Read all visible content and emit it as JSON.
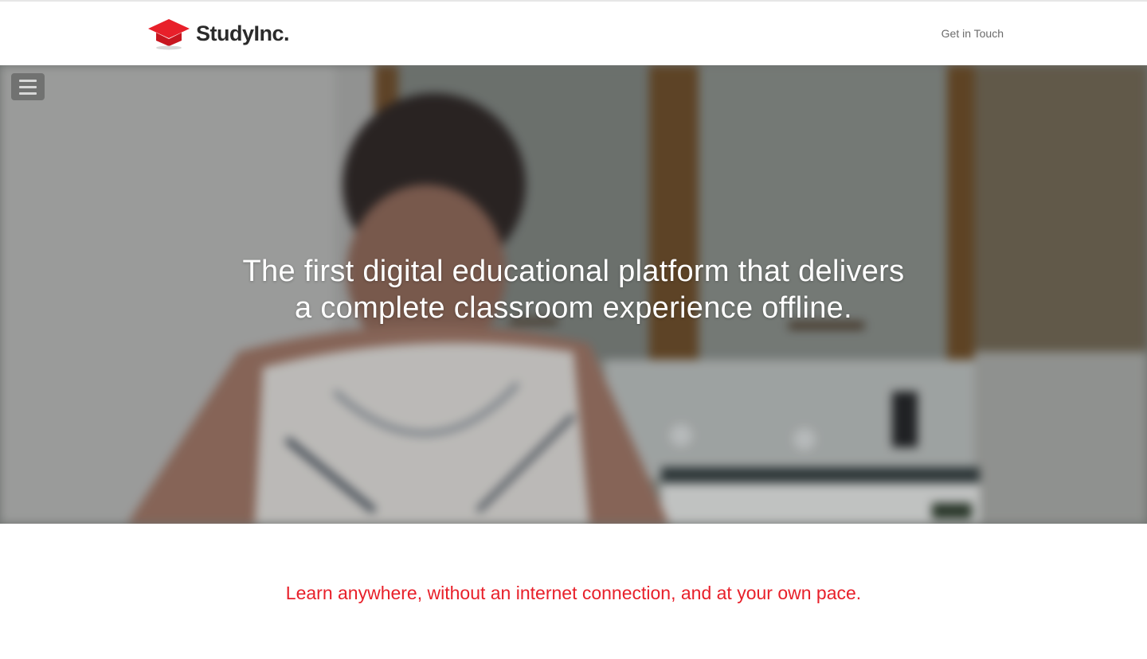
{
  "header": {
    "brand_name": "StudyInc.",
    "brand_color": "#e8202a",
    "logo_icon": "graduation-cap-icon",
    "nav_link_label": "Get in Touch"
  },
  "hero": {
    "menu_icon": "hamburger-menu-icon",
    "headline_line1": "The first digital educational platform that delivers",
    "headline_line2": "a complete classroom experience offline."
  },
  "tagline": {
    "text": "Learn anywhere, without an internet connection, and at your own pace.",
    "color": "#e8202a"
  }
}
